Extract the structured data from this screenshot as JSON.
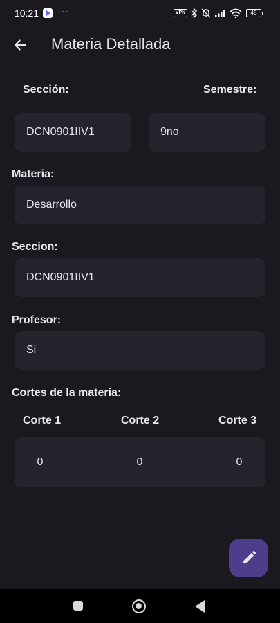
{
  "status_bar": {
    "time": "10:21",
    "more": "···",
    "vpn": "VPN",
    "battery": "48",
    "icons": [
      "play-store-icon",
      "vpn-icon",
      "bluetooth-icon",
      "bell-muted-icon",
      "signal-icon",
      "wifi-icon",
      "battery-icon"
    ]
  },
  "app_bar": {
    "title": "Materia Detallada",
    "back_icon": "arrow-left-icon"
  },
  "form": {
    "seccion_label": "Sección:",
    "semestre_label": "Semestre:",
    "seccion_value": "DCN0901IIV1",
    "semestre_value": "9no",
    "materia_label": "Materia:",
    "materia_value": "Desarrollo",
    "seccion2_label": "Seccion:",
    "seccion2_value": "DCN0901IIV1",
    "profesor_label": "Profesor:",
    "profesor_value": "Si"
  },
  "cortes": {
    "title": "Cortes de la materia:",
    "headers": [
      "Corte 1",
      "Corte 2",
      "Corte 3"
    ],
    "values": [
      "0",
      "0",
      "0"
    ]
  },
  "fab": {
    "icon": "pencil-icon"
  },
  "nav": {
    "icons": [
      "recents-icon",
      "home-icon",
      "back-icon"
    ]
  },
  "colors": {
    "background": "#1b1820",
    "field": "#26232c",
    "fab": "#4d3d8a",
    "text": "#eae5ee"
  }
}
